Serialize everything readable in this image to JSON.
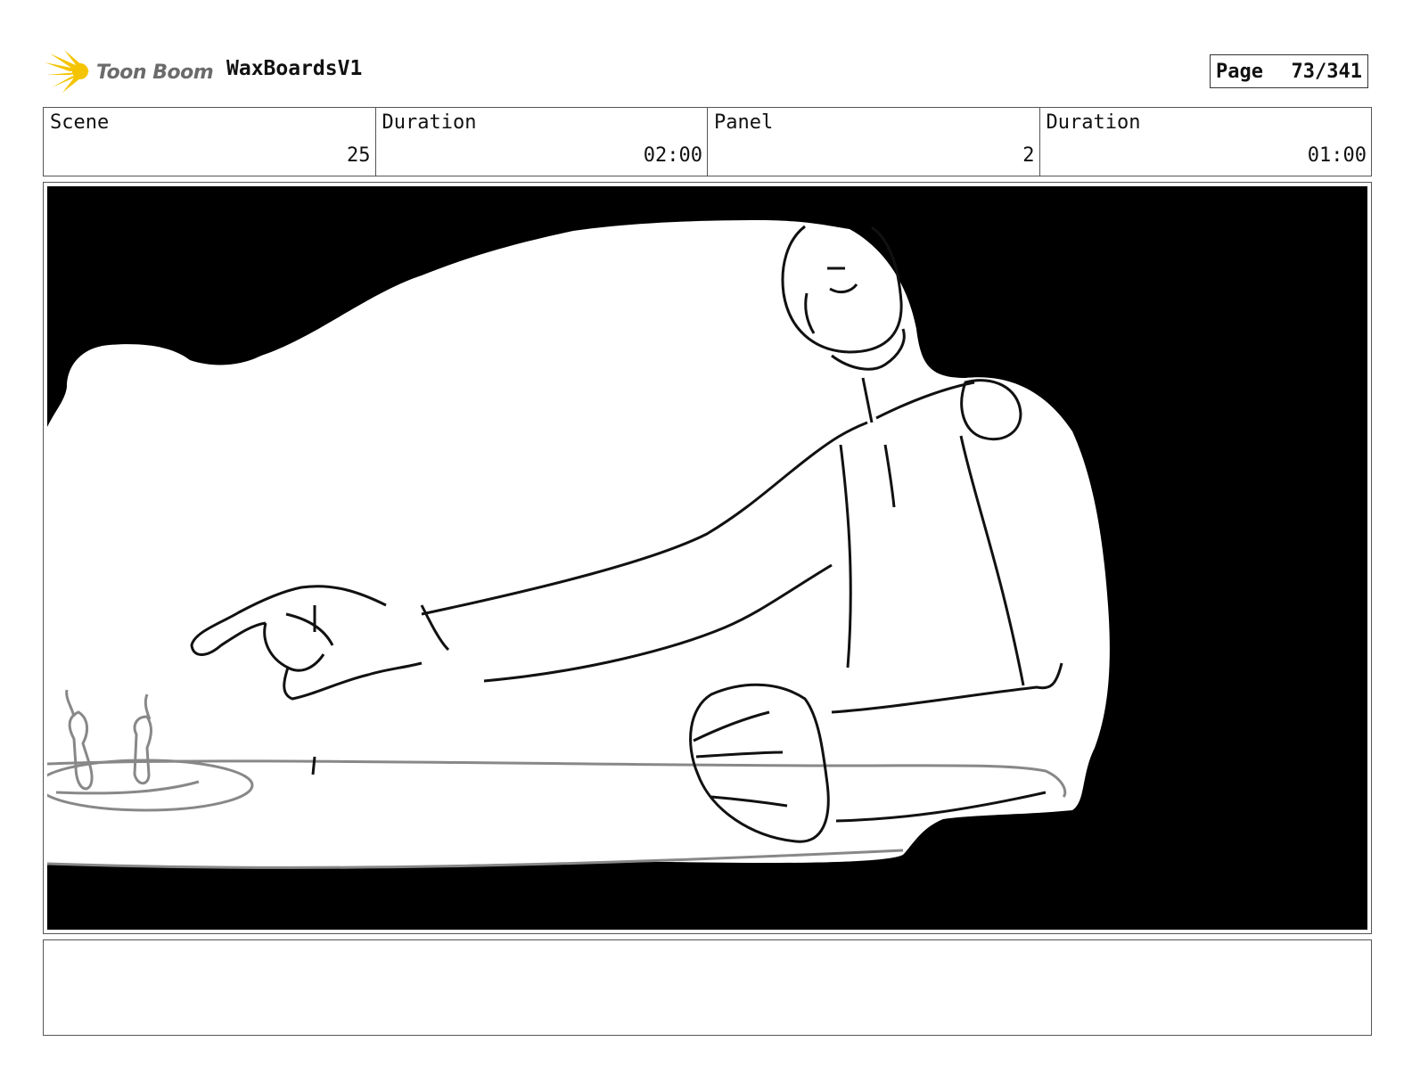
{
  "header": {
    "logo_text": "Toon Boom",
    "project_title": "WaxBoardsV1",
    "page_label": "Page",
    "page_value": "73/341"
  },
  "info": {
    "scene_label": "Scene",
    "scene_value": "25",
    "scene_duration_label": "Duration",
    "scene_duration_value": "02:00",
    "panel_label": "Panel",
    "panel_value": "2",
    "panel_duration_label": "Duration",
    "panel_duration_value": "01:00"
  },
  "notes": {
    "text": ""
  },
  "colors": {
    "logo_star": "#f5c400",
    "logo_text": "#6b6b6b",
    "panel_black": "#000000",
    "sketch_line": "#111111",
    "sketch_gray": "#888888"
  },
  "icons": {
    "logo": "toon-boom-star-icon"
  }
}
